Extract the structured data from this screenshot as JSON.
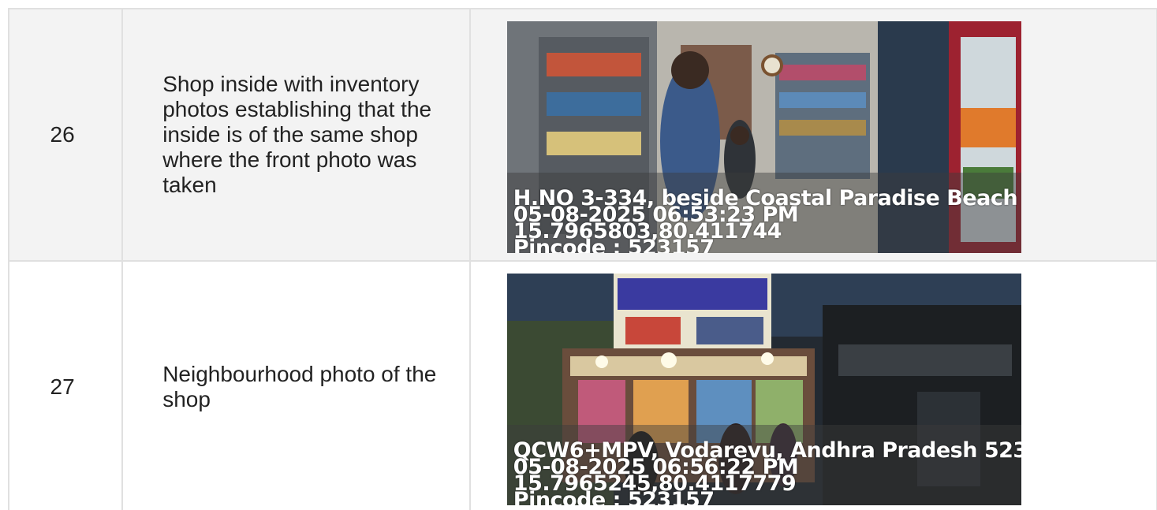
{
  "rows": [
    {
      "number": "26",
      "description": "Shop inside with inventory photos establishing that the inside is of the same shop where the front photo was taken",
      "photo": {
        "scene": "shop interior",
        "stamp": {
          "address": "H.NO 3-334, beside Coastal Paradise Beach",
          "datetime": "05-08-2025 06:53:23 PM",
          "coords": "15.7965803,80.411744",
          "pincode": "Pincode : 523157"
        }
      }
    },
    {
      "number": "27",
      "description": "Neighbourhood photo of the shop",
      "photo": {
        "scene": "shop front at night",
        "stamp": {
          "address": "QCW6+MPV, Vodarevu, Andhra Pradesh 523",
          "datetime": "05-08-2025 06:56:22 PM",
          "coords": "15.7965245,80.4117779",
          "pincode": "Pincode : 523157"
        }
      }
    }
  ]
}
